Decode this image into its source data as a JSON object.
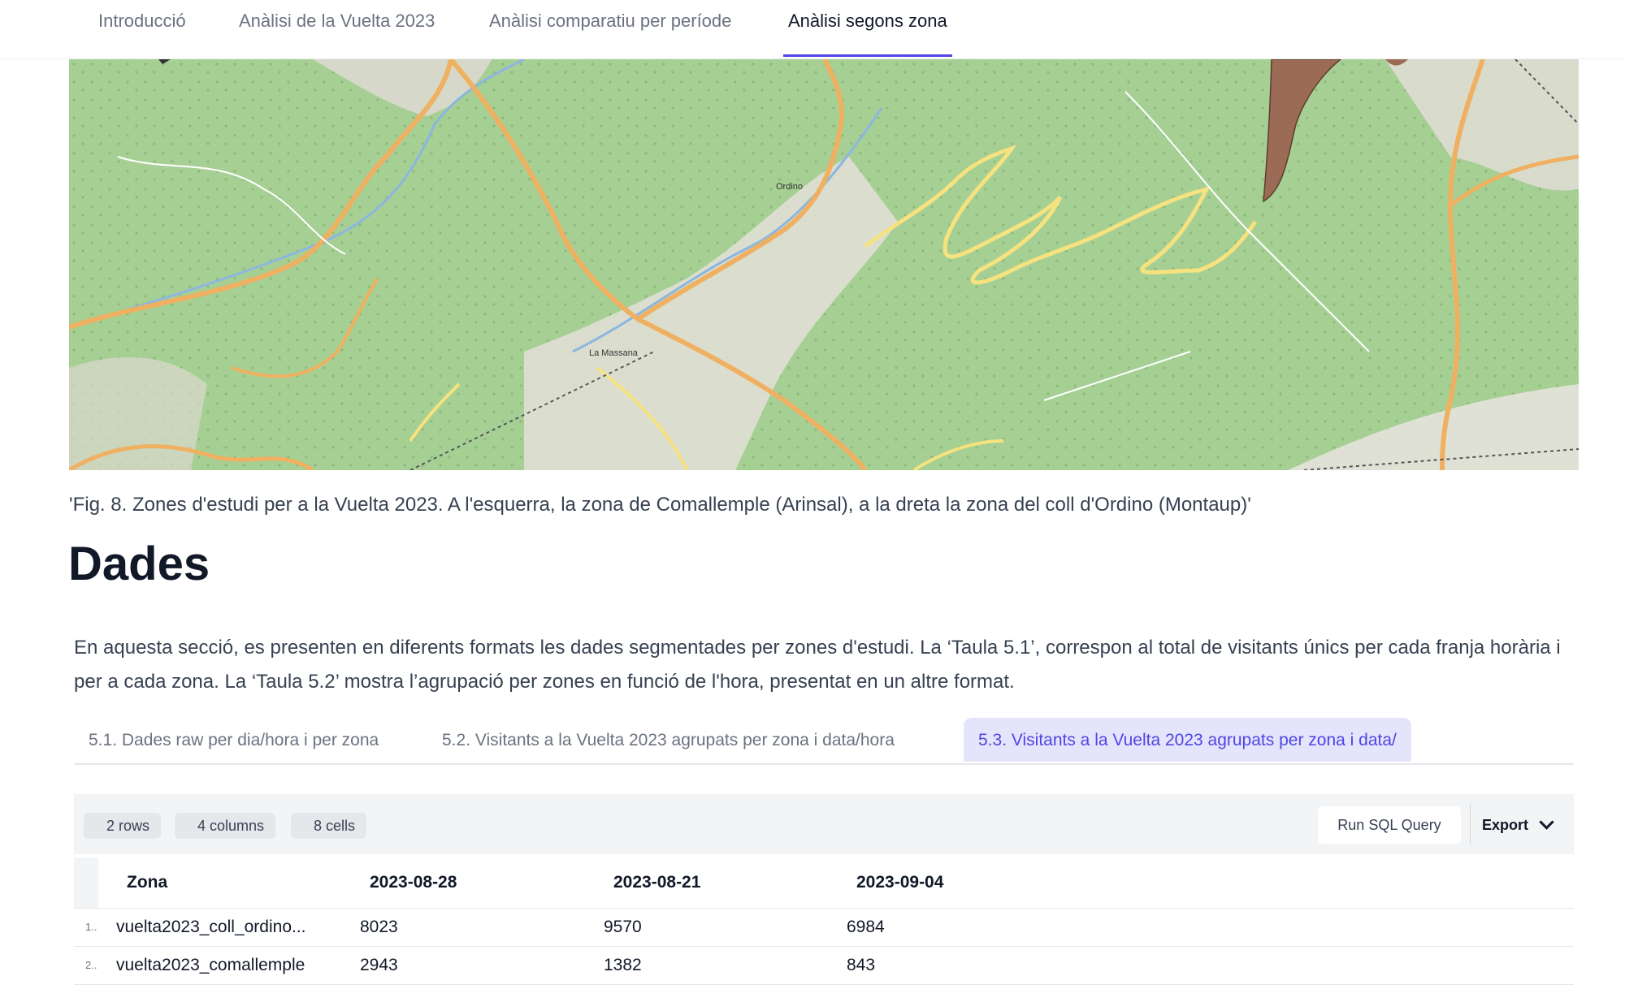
{
  "nav": {
    "tabs": [
      {
        "label": "Introducció"
      },
      {
        "label": "Anàlisi de la Vuelta 2023"
      },
      {
        "label": "Anàlisi comparatiu per període"
      },
      {
        "label": "Anàlisi segons zona"
      }
    ],
    "active_index": 3
  },
  "map": {
    "labels": {
      "ordino": "Ordino",
      "la_massana": "La Massana"
    }
  },
  "caption": "'Fig. 8. Zones d'estudi per a la Vuelta 2023. A l'esquerra, la zona de Comallemple (Arinsal), a la dreta la zona del coll d'Ordino (Montaup)'",
  "heading": "Dades",
  "paragraph": "En aquesta secció, es presenten en diferents formats les dades segmentades per zones d'estudi. La ‘Taula 5.1’, correspon al total de visitants únics per cada franja horària i per a cada zona. La ‘Taula 5.2’ mostra l’agrupació per zones en funció de l'hora, presentat en un altre format.",
  "subtabs": {
    "items": [
      {
        "label": "5.1. Dades raw per dia/hora i per zona"
      },
      {
        "label": "5.2. Visitants a la Vuelta 2023 agrupats per zona i data/hora"
      },
      {
        "label": "5.3. Visitants a la Vuelta 2023 agrupats per zona i data/"
      }
    ],
    "active_index": 2
  },
  "table": {
    "rows_pill": "2 rows",
    "columns_pill": "4 columns",
    "cells_pill": "8 cells",
    "run_sql_label": "Run SQL Query",
    "export_label": "Export",
    "columns": [
      "Zona",
      "2023-08-28",
      "2023-08-21",
      "2023-09-04"
    ],
    "rows": [
      {
        "index": "1..",
        "cells": [
          "vuelta2023_coll_ordino...",
          "8023",
          "9570",
          "6984"
        ]
      },
      {
        "index": "2..",
        "cells": [
          "vuelta2023_comallemple",
          "2943",
          "1382",
          "843"
        ]
      }
    ]
  },
  "colors": {
    "accent": "#4f46e5",
    "map_green": "#a6cf94",
    "zone_fill": "#9c6b55"
  }
}
